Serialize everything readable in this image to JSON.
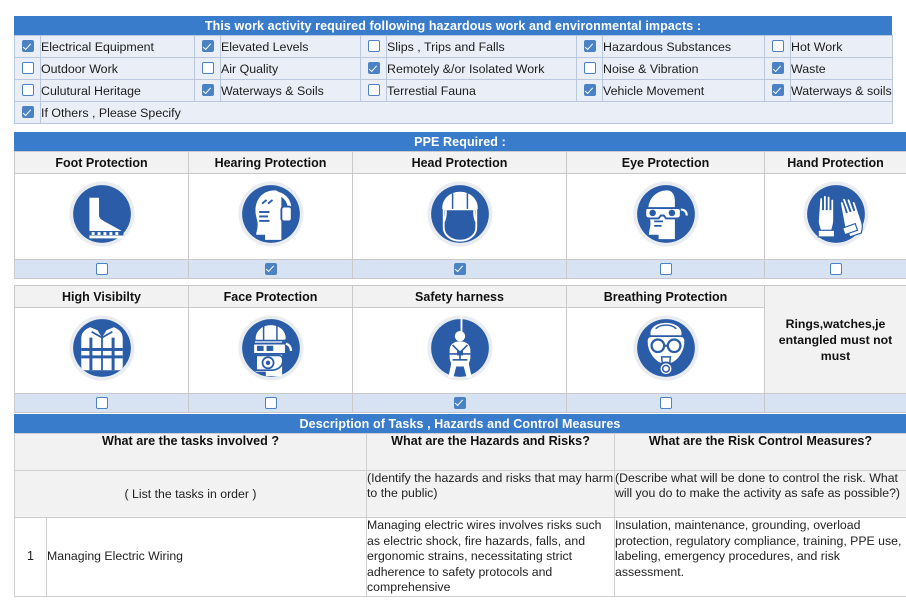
{
  "hazards": {
    "title": "This work activity required following hazardous work and environmental impacts :",
    "rows": [
      [
        {
          "label": "Electrical Equipment",
          "checked": true
        },
        {
          "label": "Elevated Levels",
          "checked": true
        },
        {
          "label": "Slips , Trips and Falls",
          "checked": false
        },
        {
          "label": "Hazardous Substances",
          "checked": true
        },
        {
          "label": "Hot Work",
          "checked": false
        }
      ],
      [
        {
          "label": "Outdoor Work",
          "checked": false
        },
        {
          "label": "Air Quality",
          "checked": false
        },
        {
          "label": "Remotely &/or Isolated Work",
          "checked": true
        },
        {
          "label": "Noise & Vibration",
          "checked": false
        },
        {
          "label": "Waste",
          "checked": true
        }
      ],
      [
        {
          "label": "Culutural Heritage",
          "checked": false
        },
        {
          "label": "Waterways & Soils",
          "checked": true
        },
        {
          "label": "Terrestial Fauna",
          "checked": false
        },
        {
          "label": "Vehicle Movement",
          "checked": true
        },
        {
          "label": "Waterways & soils",
          "checked": true
        }
      ]
    ],
    "other": {
      "label": "If Others , Please Specify",
      "checked": true
    }
  },
  "ppe": {
    "title": "PPE Required :",
    "row1": [
      {
        "label": "Foot Protection",
        "icon": "safety-boot-icon",
        "checked": false
      },
      {
        "label": "Hearing Protection",
        "icon": "ear-protection-icon",
        "checked": true
      },
      {
        "label": "Head Protection",
        "icon": "hard-hat-icon",
        "checked": true
      },
      {
        "label": "Eye Protection",
        "icon": "safety-goggles-icon",
        "checked": false
      },
      {
        "label": "Hand Protection",
        "icon": "safety-gloves-icon",
        "checked": false
      }
    ],
    "row2": [
      {
        "label": "High Visibilty",
        "icon": "hi-vis-vest-icon",
        "checked": false
      },
      {
        "label": "Face Protection",
        "icon": "face-shield-icon",
        "checked": false
      },
      {
        "label": "Safety harness",
        "icon": "safety-harness-icon",
        "checked": true
      },
      {
        "label": "Breathing Protection",
        "icon": "respirator-mask-icon",
        "checked": false
      }
    ],
    "note_lines": [
      "Rings,watches,je",
      "entangled must not",
      "must"
    ]
  },
  "description": {
    "title": "Description of Tasks , Hazards and Control Measures",
    "headers": [
      "What are the tasks involved ?",
      "What are the Hazards and Risks?",
      "What are the Risk Control Measures?"
    ],
    "subheaders": [
      "( List the tasks in order )",
      "(Identify the hazards and risks that may harm to the public)",
      "(Describe what will be done to control the risk. What will you do to make the activity as safe as possible?)"
    ],
    "rows": [
      {
        "number": "1",
        "task": "Managing Electric Wiring",
        "hazards": "Managing electric wires involves risks such as electric shock, fire hazards, falls, and ergonomic strains, necessitating strict adherence to safety protocols and comprehensive",
        "controls": "Insulation, maintenance, grounding, overload protection, regulatory compliance, training, PPE use, labeling, emergency procedures, and risk assessment."
      }
    ]
  },
  "colors": {
    "band_blue": "#3a7ccc",
    "icon_blue": "#2a5ca8",
    "check_blue": "#4a82c4",
    "hazard_row_bg": "#eaeff7",
    "ppe_check_bg": "#d7e3f2"
  }
}
